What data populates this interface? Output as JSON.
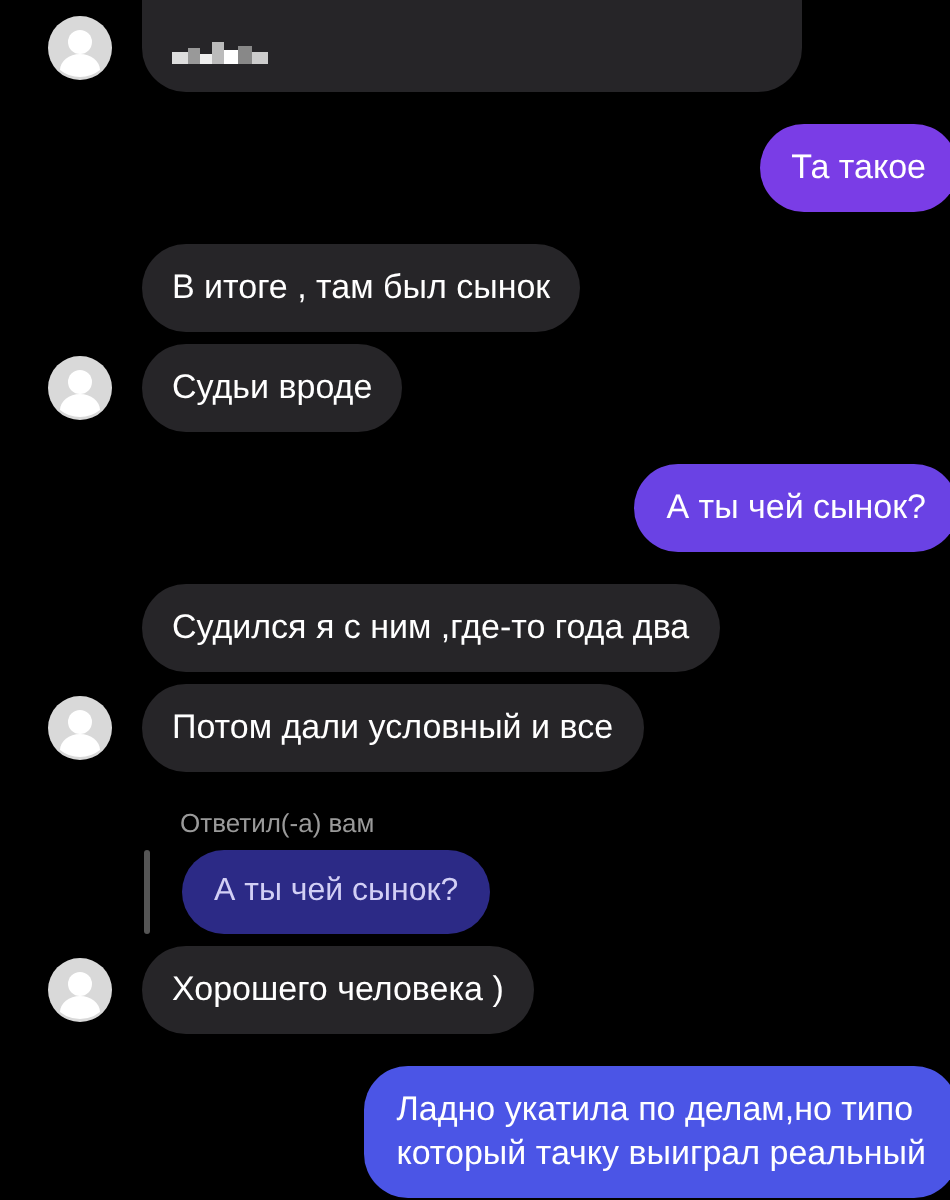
{
  "messages": [
    {
      "kind": "incoming",
      "redacted": true,
      "avatar": true
    },
    {
      "kind": "outgoing",
      "lines": [
        "Та такое"
      ],
      "color": "#7a3de6"
    },
    {
      "kind": "incoming",
      "lines": [
        "В итоге , там был сынок"
      ],
      "avatar": false
    },
    {
      "kind": "incoming",
      "lines": [
        "Судьи вроде"
      ],
      "avatar": true
    },
    {
      "kind": "outgoing",
      "lines": [
        "А ты чей сынок?"
      ],
      "color": "#6a42e4"
    },
    {
      "kind": "incoming",
      "lines": [
        "Судился я с ним ,где-то года два"
      ],
      "avatar": false
    },
    {
      "kind": "incoming",
      "lines": [
        "Потом дали условный и все"
      ],
      "avatar": true
    },
    {
      "kind": "reply-label",
      "text": "Ответил(-а) вам"
    },
    {
      "kind": "quoted",
      "text": "А ты чей сынок?"
    },
    {
      "kind": "incoming",
      "lines": [
        "Хорошего человека )"
      ],
      "avatar": true
    },
    {
      "kind": "outgoing",
      "lines": [
        "Ладно укатила по делам,но типо",
        "который тачку выиграл реальный"
      ],
      "color": "#4b55e6"
    }
  ]
}
